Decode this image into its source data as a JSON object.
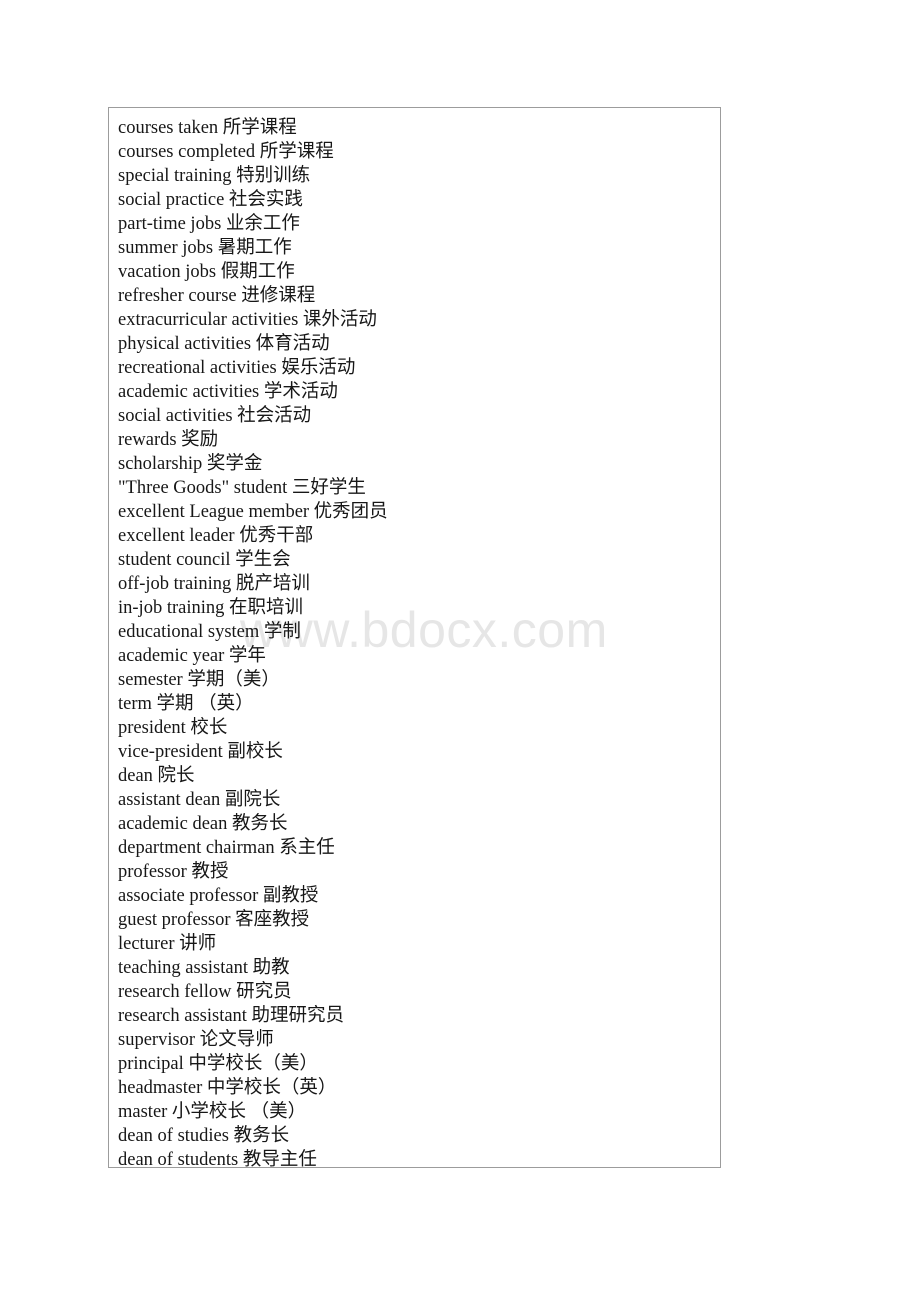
{
  "document": {
    "watermark": "www.bdocx.com",
    "border_color": "#9c9c9c",
    "text_color": "#171717",
    "background_color": "#ffffff",
    "watermark_color": "#e6e6e6"
  },
  "glossary": {
    "entries": [
      "courses taken 所学课程",
      "courses completed 所学课程",
      "special training 特别训练",
      "social practice 社会实践",
      "part-time jobs 业余工作",
      "summer jobs 暑期工作",
      "vacation jobs 假期工作",
      "refresher course 进修课程",
      "extracurricular activities 课外活动",
      "physical activities 体育活动",
      "recreational activities 娱乐活动",
      "academic activities 学术活动",
      "social activities 社会活动",
      "rewards 奖励",
      "scholarship 奖学金",
      "\"Three Goods\" student 三好学生",
      "excellent League member 优秀团员",
      "excellent leader 优秀干部",
      "student council 学生会",
      "off-job training 脱产培训",
      "in-job training 在职培训",
      "educational system 学制",
      "academic year 学年",
      "semester 学期（美）",
      "term 学期 （英）",
      "president 校长",
      "vice-president 副校长",
      "dean 院长",
      "assistant dean 副院长",
      "academic dean 教务长",
      "department chairman 系主任",
      "professor 教授",
      "associate professor 副教授",
      "guest professor 客座教授",
      "lecturer 讲师",
      "teaching assistant 助教",
      "research fellow 研究员",
      "research assistant 助理研究员",
      "supervisor 论文导师",
      "principal 中学校长（美）",
      "headmaster 中学校长（英）",
      "master 小学校长 （美）",
      "dean of studies 教务长",
      "dean of students 教导主任"
    ]
  }
}
